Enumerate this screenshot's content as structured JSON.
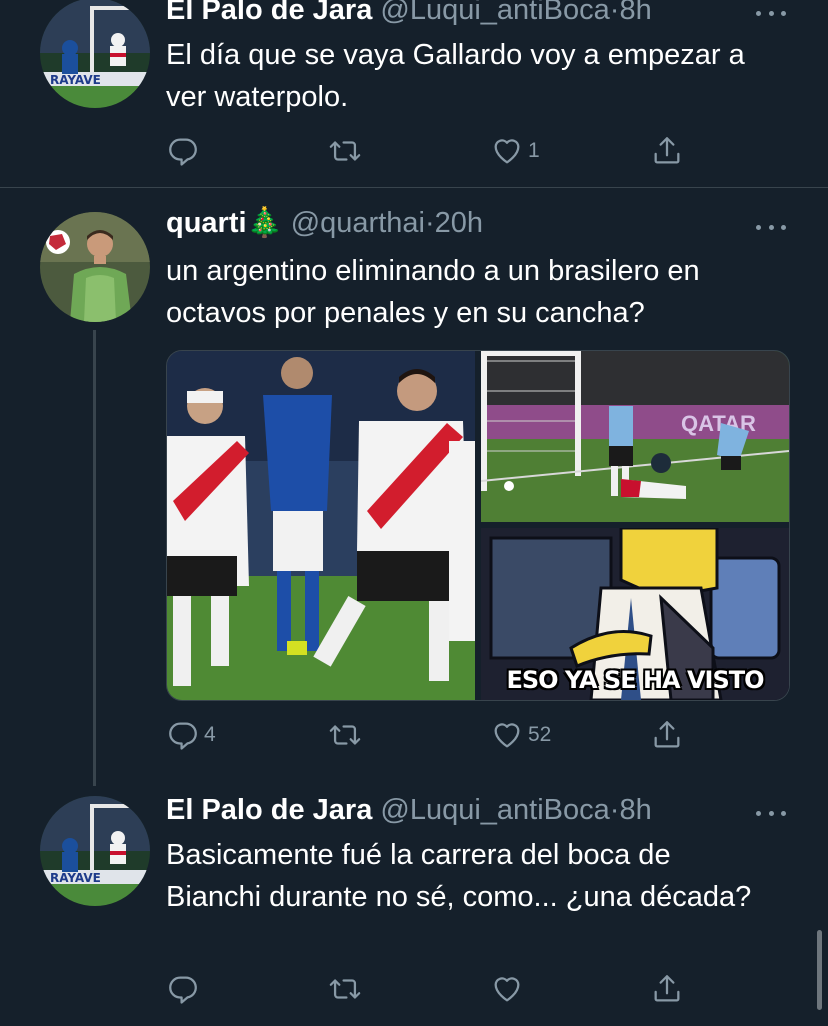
{
  "tweets": [
    {
      "name": "El Palo de Jara",
      "handle": "@Luqui_antiBoca",
      "dot": "·",
      "time": "8h",
      "text": "El día que se vaya Gallardo voy a empezar a ver waterpolo.",
      "actions": {
        "replies": "",
        "retweets": "",
        "likes": "1"
      }
    },
    {
      "name": "quarti",
      "emoji": "🎄",
      "handle": "@quarthai",
      "dot": "·",
      "time": "20h",
      "text": "un argentino eliminando a un brasilero en octavos por penales y en su cancha?",
      "media": {
        "meme_caption": "ESO YA SE HA VISTO",
        "banner_text": "QATAR"
      },
      "actions": {
        "replies": "4",
        "retweets": "",
        "likes": "52"
      }
    },
    {
      "name": "El Palo de Jara",
      "handle": "@Luqui_antiBoca",
      "dot": "·",
      "time": "8h",
      "text": "Basicamente fué la carrera del boca de Bianchi durante no sé, como... ¿una década?",
      "actions": {
        "replies": "",
        "retweets": "",
        "likes": ""
      }
    }
  ],
  "colors": {
    "background": "#15202b",
    "secondary_text": "#8899a6",
    "divider": "#38444d",
    "primary_text": "#ffffff"
  },
  "icons": [
    "reply-icon",
    "retweet-icon",
    "like-icon",
    "share-icon",
    "more-options-icon"
  ]
}
